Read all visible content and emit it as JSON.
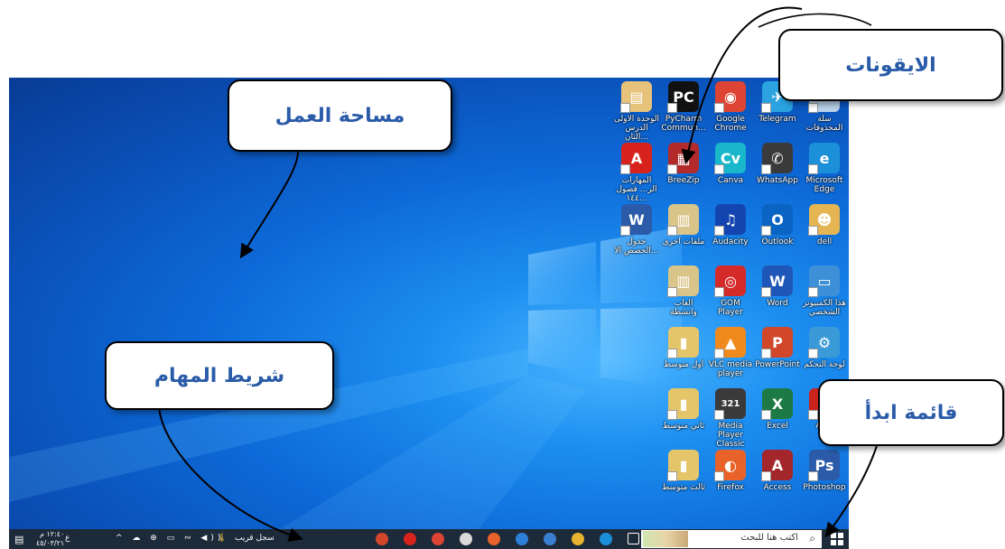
{
  "callouts": {
    "icons": "الايقونات",
    "workspace": "مساحة العمل",
    "taskbar": "شريط المهام",
    "start_menu": "قائمة ابدأ"
  },
  "desktop_icons": [
    {
      "label": "سلة المحذوفات",
      "icon": "recycle-bin-icon",
      "color": "#b9d2ea",
      "glyph": "♻"
    },
    {
      "label": "Telegram",
      "icon": "telegram-icon",
      "color": "#2aa3e0",
      "glyph": "✈"
    },
    {
      "label": "Google Chrome",
      "icon": "chrome-icon",
      "color": "#dd4433",
      "glyph": "◉"
    },
    {
      "label": "PyCharm Commun...",
      "icon": "pycharm-icon",
      "color": "#111111",
      "glyph": "PC"
    },
    {
      "label": "الوحدة الاولى الدرس الثان...",
      "icon": "document-folder-icon",
      "color": "#e6c27a",
      "glyph": "▤"
    },
    {
      "label": "Microsoft Edge",
      "icon": "edge-icon",
      "color": "#1b8fd8",
      "glyph": "e"
    },
    {
      "label": "WhatsApp",
      "icon": "whatsapp-icon",
      "color": "#3a3a3a",
      "glyph": "✆"
    },
    {
      "label": "Canva",
      "icon": "canva-icon",
      "color": "#18b7c9",
      "glyph": "Cv"
    },
    {
      "label": "BreeZip",
      "icon": "breezip-icon",
      "color": "#b22a2a",
      "glyph": "▦"
    },
    {
      "label": "المهارات الر... فصول ١٤٤...",
      "icon": "pdf-icon",
      "color": "#d8231c",
      "glyph": "A"
    },
    {
      "label": "dell",
      "icon": "user-folder-icon",
      "color": "#e4b552",
      "glyph": "☻"
    },
    {
      "label": "Outlook",
      "icon": "outlook-icon",
      "color": "#0a64c4",
      "glyph": "O"
    },
    {
      "label": "Audacity",
      "icon": "audacity-icon",
      "color": "#1345b0",
      "glyph": "♫"
    },
    {
      "label": "ملفات اخرى",
      "icon": "folder-files-icon",
      "color": "#d9c48a",
      "glyph": "▥"
    },
    {
      "label": "جدول الحصص الا...",
      "icon": "word-doc-icon",
      "color": "#2b5aa8",
      "glyph": "W"
    },
    {
      "label": "هذا الكمبيوتر الشخصي",
      "icon": "this-pc-icon",
      "color": "#3d8fd8",
      "glyph": "▭"
    },
    {
      "label": "Word",
      "icon": "word-icon",
      "color": "#1f57b8",
      "glyph": "W"
    },
    {
      "label": "GOM Player",
      "icon": "gom-player-icon",
      "color": "#d42a2a",
      "glyph": "◎"
    },
    {
      "label": "العاب وانشطة",
      "icon": "games-folder-icon",
      "color": "#d9c48a",
      "glyph": "▥"
    },
    {
      "label": "لوحة التحكم",
      "icon": "control-panel-icon",
      "color": "#3a9ad8",
      "glyph": "⚙"
    },
    {
      "label": "PowerPoint",
      "icon": "powerpoint-icon",
      "color": "#d2472a",
      "glyph": "P"
    },
    {
      "label": "VLC media player",
      "icon": "vlc-icon",
      "color": "#f08a1c",
      "glyph": "▲"
    },
    {
      "label": "اول متوسط",
      "icon": "folder-icon",
      "color": "#e5c56a",
      "glyph": "▮"
    },
    {
      "label": "Ac...",
      "icon": "acrobat-icon",
      "color": "#c8231c",
      "glyph": "A"
    },
    {
      "label": "Excel",
      "icon": "excel-icon",
      "color": "#1e7a44",
      "glyph": "X"
    },
    {
      "label": "Media Player Classic",
      "icon": "media-player-classic-icon",
      "color": "#3a3a3a",
      "glyph": "321"
    },
    {
      "label": "ثاني متوسط",
      "icon": "folder-icon",
      "color": "#e5c56a",
      "glyph": "▮"
    },
    {
      "label": "Photoshop",
      "icon": "photoshop-icon",
      "color": "#2b5aa8",
      "glyph": "Ps"
    },
    {
      "label": "Access",
      "icon": "access-icon",
      "color": "#a3262b",
      "glyph": "A"
    },
    {
      "label": "Firefox",
      "icon": "firefox-icon",
      "color": "#e8622a",
      "glyph": "◐"
    },
    {
      "label": "ثالث متوسط",
      "icon": "folder-icon",
      "color": "#e5c56a",
      "glyph": "▮"
    }
  ],
  "taskbar": {
    "search_placeholder": "اكتب هنا للبحث",
    "weather_text": "سجل قريب",
    "clock_time": "١٢:٤٠ م",
    "clock_date": "٤٥/٠٣/٢١",
    "language": "ع",
    "pinned_apps": [
      {
        "icon": "task-view-icon",
        "color": "#ffffff"
      },
      {
        "icon": "edge-icon",
        "color": "#1b8fd8"
      },
      {
        "icon": "file-explorer-icon",
        "color": "#e8b430"
      },
      {
        "icon": "store-icon",
        "color": "#3a7fd0"
      },
      {
        "icon": "mail-icon",
        "color": "#2d7fd8"
      },
      {
        "icon": "firefox-icon",
        "color": "#e8622a"
      },
      {
        "icon": "paint-icon",
        "color": "#d9d9d9"
      },
      {
        "icon": "chrome-icon",
        "color": "#dd4433"
      },
      {
        "icon": "pdf-icon",
        "color": "#d8231c"
      },
      {
        "icon": "powerpoint-icon",
        "color": "#d2472a"
      }
    ]
  }
}
